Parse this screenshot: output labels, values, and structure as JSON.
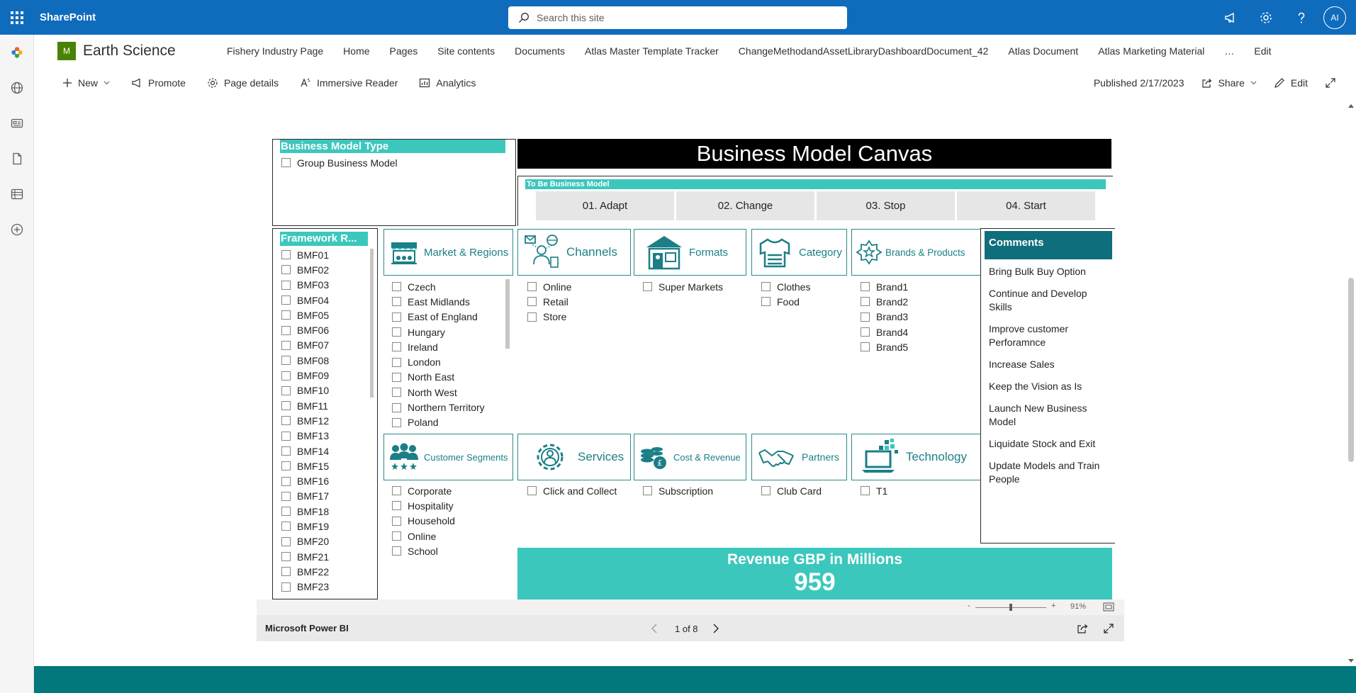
{
  "suitebar": {
    "app_name": "SharePoint",
    "search_placeholder": "Search this site",
    "avatar_initials": "AI"
  },
  "site": {
    "logo_letter": "M",
    "title": "Earth Science"
  },
  "topnav": [
    "Fishery Industry Page",
    "Home",
    "Pages",
    "Site contents",
    "Documents",
    "Atlas Master Template Tracker",
    "ChangeMethodandAssetLibraryDashboardDocument_42",
    "Atlas Document",
    "Atlas Marketing Material",
    "…",
    "Edit"
  ],
  "command_bar": {
    "new": "New",
    "promote": "Promote",
    "page_details": "Page details",
    "immersive_reader": "Immersive Reader",
    "analytics": "Analytics",
    "published": "Published 2/17/2023",
    "share": "Share",
    "edit": "Edit"
  },
  "report": {
    "business_model_type": {
      "header": "Business Model Type",
      "options": [
        "Group Business Model"
      ]
    },
    "canvas_title": "Business Model Canvas",
    "to_be": {
      "header": "To Be Business Model",
      "buttons": [
        "01. Adapt",
        "02. Change",
        "03. Stop",
        "04. Start"
      ]
    },
    "framework": {
      "header": "Framework R...",
      "items": [
        "BMF01",
        "BMF02",
        "BMF03",
        "BMF04",
        "BMF05",
        "BMF06",
        "BMF07",
        "BMF08",
        "BMF09",
        "BMF10",
        "BMF11",
        "BMF12",
        "BMF13",
        "BMF14",
        "BMF15",
        "BMF16",
        "BMF17",
        "BMF18",
        "BMF19",
        "BMF20",
        "BMF21",
        "BMF22",
        "BMF23"
      ]
    },
    "market_regions": {
      "label": "Market & Regions",
      "items": [
        "Czech",
        "East Midlands",
        "East of England",
        "Hungary",
        "Ireland",
        "London",
        "North East",
        "North West",
        "Northern Territory",
        "Poland"
      ]
    },
    "channels": {
      "label": "Channels",
      "items": [
        "Online",
        "Retail",
        "Store"
      ]
    },
    "formats": {
      "label": "Formats",
      "items": [
        "Super Markets"
      ]
    },
    "category": {
      "label": "Category",
      "items": [
        "Clothes",
        "Food"
      ]
    },
    "brands_products": {
      "label": "Brands & Products",
      "items": [
        "Brand1",
        "Brand2",
        "Brand3",
        "Brand4",
        "Brand5"
      ]
    },
    "customer_segments": {
      "label": "Customer Segments",
      "items": [
        "Corporate",
        "Hospitality",
        "Household",
        "Online",
        "School"
      ]
    },
    "services": {
      "label": "Services",
      "items": [
        "Click and Collect"
      ]
    },
    "cost_revenue": {
      "label": "Cost & Revenue",
      "items": [
        "Subscription"
      ]
    },
    "partners": {
      "label": "Partners",
      "items": [
        "Club Card"
      ]
    },
    "technology": {
      "label": "Technology",
      "items": [
        "T1"
      ]
    },
    "comments": {
      "header": "Comments",
      "items": [
        "Bring Bulk Buy Option",
        "Continue and Develop Skills",
        "Improve customer Perforamnce",
        "Increase Sales",
        "Keep the Vision as Is",
        "Launch New Business Model",
        "Liquidate Stock and Exit",
        "Update Models and Train People"
      ]
    },
    "revenue": {
      "label": "Revenue GBP in Millions",
      "value": "959"
    }
  },
  "pbi": {
    "zoom": "91%",
    "zoom_minus": "-",
    "zoom_plus": "+",
    "zoom_level": 0.5,
    "brand": "Microsoft Power BI",
    "page_indicator": "1 of 8"
  },
  "colors": {
    "suitebar": "#0f6cbd",
    "teal": "#3cc7bd",
    "dark_teal": "#0e6e7c",
    "footer": "#03787c"
  }
}
